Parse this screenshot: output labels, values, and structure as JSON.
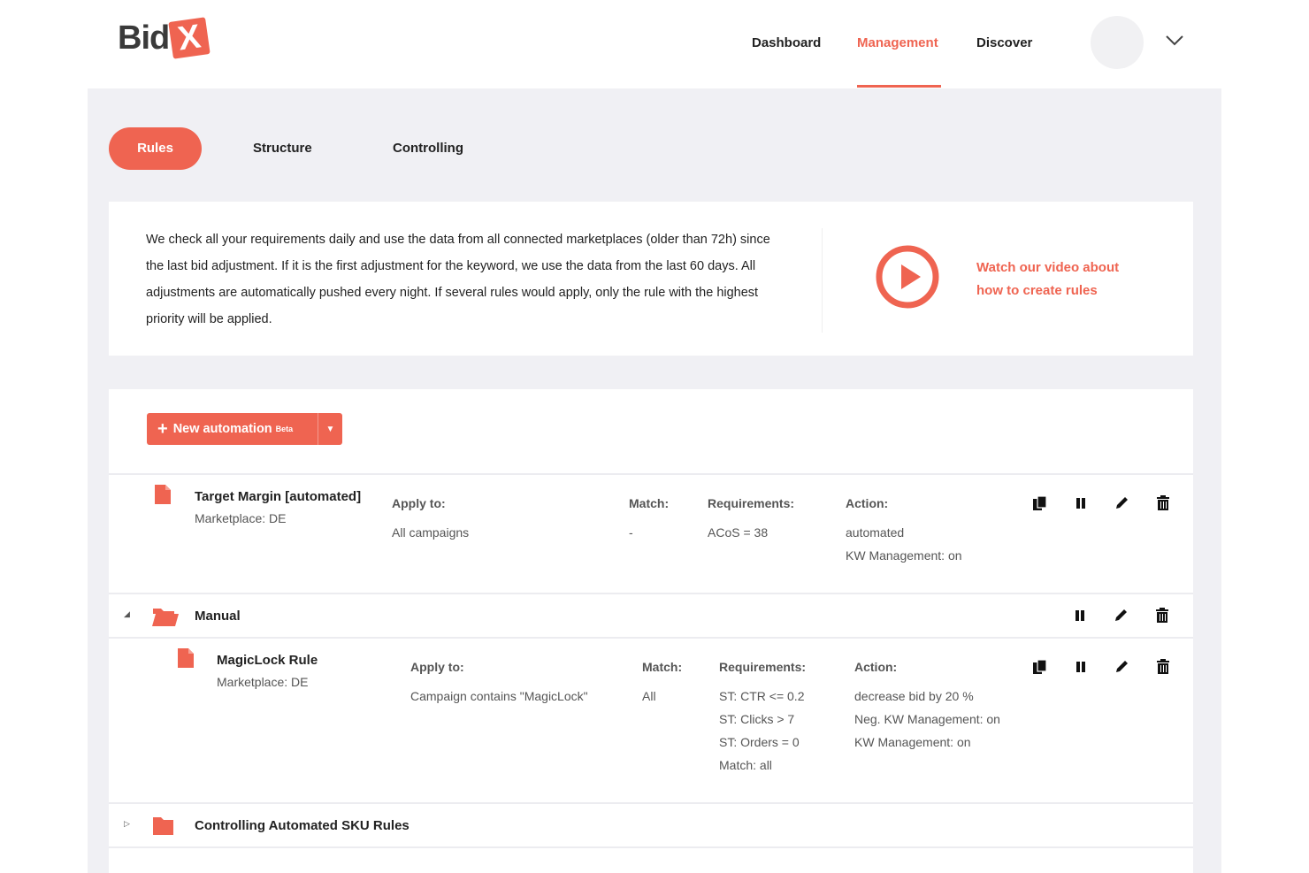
{
  "header": {
    "logo_text": "Bid",
    "logo_mark": "X",
    "nav": [
      "Dashboard",
      "Management",
      "Discover"
    ],
    "active_nav": "Management",
    "brand_color": "#ef6451"
  },
  "tabs": [
    "Rules",
    "Structure",
    "Controlling"
  ],
  "info": {
    "text": "We check all your requirements daily and use the data from all connected marketplaces (older than 72h) since the last bid adjustment. If it is the first adjustment for the keyword, we use the data from the last 60 days. All adjustments are automatically pushed every night. If several rules would apply, only the rule with the highest priority will be applied.",
    "video_line1": "Watch our video about",
    "video_line2": "how to create rules"
  },
  "new_automation": {
    "label": "New automation",
    "badge": "Beta"
  },
  "rules": [
    {
      "title": "Target Margin [automated]",
      "marketplace": "Marketplace: DE",
      "apply_head": "Apply to:",
      "apply": "All campaigns",
      "match_head": "Match:",
      "match": "-",
      "req_head": "Requirements:",
      "requirements": [
        "ACoS = 38"
      ],
      "action_head": "Action:",
      "actions": [
        "automated",
        "KW Management: on"
      ]
    },
    {
      "title": "MagicLock Rule",
      "marketplace": "Marketplace: DE",
      "apply_head": "Apply to:",
      "apply": "Campaign contains \"MagicLock\"",
      "match_head": "Match:",
      "match": "All",
      "req_head": "Requirements:",
      "requirements": [
        "ST: CTR <= 0.2",
        "ST: Clicks > 7",
        "ST: Orders = 0",
        "Match: all"
      ],
      "action_head": "Action:",
      "actions": [
        "decrease bid by 20 %",
        "Neg. KW Management: on",
        "KW Management: on"
      ]
    }
  ],
  "folders": [
    {
      "name": "Manual",
      "expanded": true
    },
    {
      "name": "Controlling Automated SKU Rules",
      "expanded": false
    }
  ],
  "icons": [
    "copy-icon",
    "pause-icon",
    "edit-icon",
    "trash-icon",
    "play-icon",
    "file-icon",
    "folder-icon",
    "chevron-down-icon"
  ]
}
